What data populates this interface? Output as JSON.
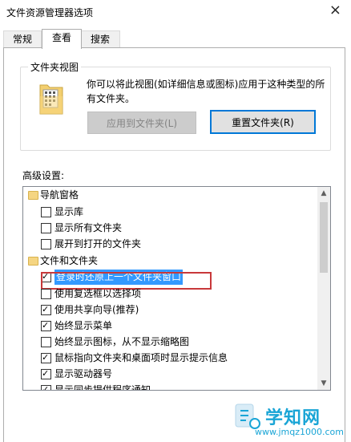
{
  "window": {
    "title": "文件资源管理器选项",
    "close_glyph": "×"
  },
  "tabs": [
    {
      "label": "常规",
      "active": false
    },
    {
      "label": "查看",
      "active": true
    },
    {
      "label": "搜索",
      "active": false
    }
  ],
  "folder_views": {
    "group_label": "文件夹视图",
    "description": "你可以将此视图(如详细信息或图标)应用于这种类型的所有文件夹。",
    "apply_button": "应用到文件夹(L)",
    "reset_button": "重置文件夹(R)"
  },
  "advanced": {
    "label": "高级设置:",
    "items": [
      {
        "type": "folder",
        "label": "导航窗格"
      },
      {
        "type": "checkbox",
        "label": "显示库",
        "checked": false
      },
      {
        "type": "checkbox",
        "label": "显示所有文件夹",
        "checked": false
      },
      {
        "type": "checkbox",
        "label": "展开到打开的文件夹",
        "checked": false
      },
      {
        "type": "folder",
        "label": "文件和文件夹"
      },
      {
        "type": "checkbox",
        "label": "登录时还原上一个文件夹窗口",
        "checked": true,
        "selected": true
      },
      {
        "type": "checkbox",
        "label": "使用复选框以选择项",
        "checked": false
      },
      {
        "type": "checkbox",
        "label": "使用共享向导(推荐)",
        "checked": true
      },
      {
        "type": "checkbox",
        "label": "始终显示菜单",
        "checked": true
      },
      {
        "type": "checkbox",
        "label": "始终显示图标，从不显示缩略图",
        "checked": false
      },
      {
        "type": "checkbox",
        "label": "鼠标指向文件夹和桌面项时显示提示信息",
        "checked": true
      },
      {
        "type": "checkbox",
        "label": "显示驱动器号",
        "checked": true
      },
      {
        "type": "checkbox",
        "label": "显示同步提供程序通知",
        "checked": true
      }
    ]
  },
  "scrollbar": {
    "up_glyph": "▲",
    "down_glyph": "▼"
  },
  "watermark": {
    "name": "学知网",
    "url": "www.jmqz1000.com"
  },
  "colors": {
    "accent": "#0078d7",
    "selection": "#3399ff",
    "highlight_frame": "#c8383a",
    "watermark": "#1aa5d6"
  }
}
